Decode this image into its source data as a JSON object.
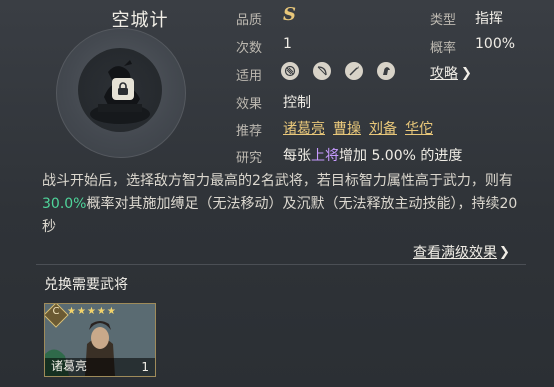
{
  "skill": {
    "name": "空城计",
    "quality_label": "品质",
    "quality_value": "S",
    "type_label": "类型",
    "type_value": "指挥",
    "uses_label": "次数",
    "uses_value": "1",
    "rate_label": "概率",
    "rate_value": "100%",
    "applicable_label": "适用",
    "applicable_icons": [
      "shield-icon",
      "bow-icon",
      "spear-icon",
      "horse-icon"
    ],
    "guide_link": "攻略",
    "effect_label": "效果",
    "effect_value": "控制",
    "recommend_label": "推荐",
    "recommend_generals": [
      "诸葛亮",
      "曹操",
      "刘备",
      "华佗"
    ],
    "research_label": "研究",
    "research_prefix": "每张",
    "research_highlight": "上将",
    "research_suffix": "增加 5.00% 的进度",
    "description_part1": "战斗开始后，选择敌方智力最高的2名武将，若目标智力属性高于武力，则有",
    "description_highlight": "30.0%",
    "description_part2": "概率对其施加缚足（无法移动）及沉默（无法释放主动技能），持续20秒",
    "full_effect_link": "查看满级效果"
  },
  "exchange": {
    "title": "兑换需要武将",
    "card": {
      "name": "诸葛亮",
      "count": "1",
      "stars": 5,
      "grade_badge": "C"
    }
  },
  "colors": {
    "gold": "#e8c77a",
    "purple": "#c79bff",
    "green": "#4fd49a"
  }
}
